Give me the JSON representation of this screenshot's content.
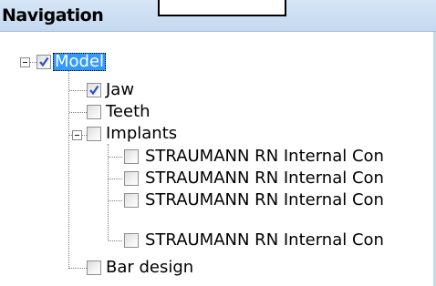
{
  "panel": {
    "title": "Navigation"
  },
  "tree": {
    "root": {
      "label": "Model",
      "checked": true,
      "expanded": true,
      "selected": true
    },
    "jaw": {
      "label": "Jaw",
      "checked": true
    },
    "teeth": {
      "label": "Teeth",
      "checked": false
    },
    "implants": {
      "label": "Implants",
      "checked": false,
      "expanded": true,
      "children": [
        {
          "label": "STRAUMANN RN Internal Con",
          "checked": false
        },
        {
          "label": "STRAUMANN RN Internal Con",
          "checked": false
        },
        {
          "label": "STRAUMANN RN Internal Con",
          "checked": false
        },
        {
          "label": "STRAUMANN RN Internal Con",
          "checked": false
        }
      ]
    },
    "bar": {
      "label": "Bar design",
      "checked": false
    }
  },
  "colors": {
    "header_bg": "#c9dcf2",
    "selection": "#3399ff",
    "check": "#2a4fc4"
  }
}
